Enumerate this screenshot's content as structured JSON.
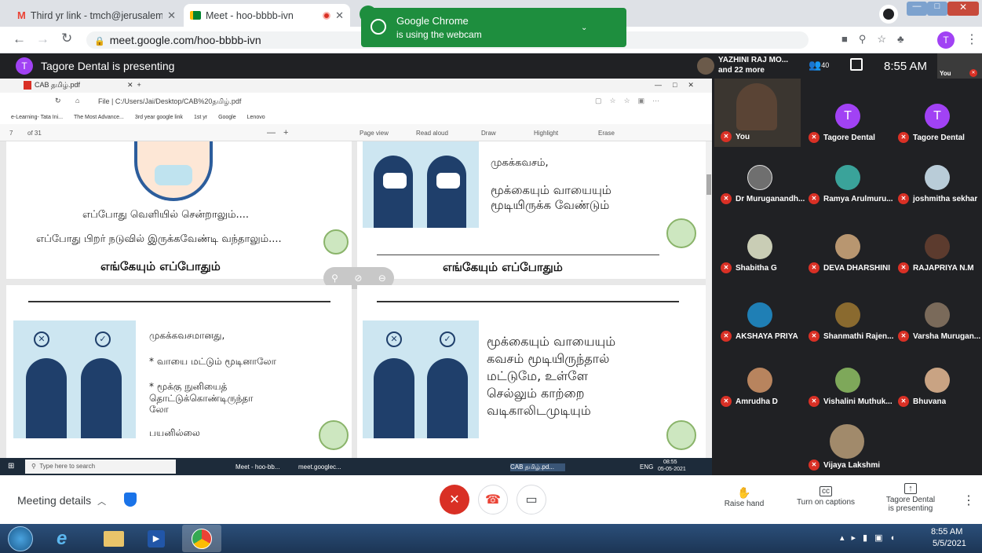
{
  "browser": {
    "tabs": [
      {
        "title": "Third yr link - tmch@jerusalemer",
        "icon": "gmail-icon"
      },
      {
        "title": "Meet - hoo-bbbb-ivn",
        "icon": "meet-icon"
      }
    ],
    "url": "meet.google.com/hoo-bbbb-ivn",
    "notification": {
      "line1": "Google Chrome",
      "line2": "is using the webcam"
    },
    "profile_initial": "T"
  },
  "meet_header": {
    "presenter_initial": "T",
    "presenting_text": "Tagore Dental is presenting",
    "speaker_name": "YAZHINI RAJ MO...",
    "speaker_more": "and 22 more",
    "people_count": "40",
    "time": "8:55 AM",
    "self_label": "You"
  },
  "shared_window": {
    "tab_title": "CAB தமிழ்.pdf",
    "address": "File  |  C:/Users/Jai/Desktop/CAB%20தமிழ்.pdf",
    "bookmarks": [
      "e-Learning- Tata Ini...",
      "The Most Advance...",
      "3rd year google link",
      "1st yr",
      "Google",
      "Lenovo"
    ],
    "page_num": "7",
    "page_total": "of 31",
    "toolbar": [
      "Page view",
      "Read aloud",
      "Draw",
      "Highlight",
      "Erase"
    ],
    "slide1_line1": "எப்போது வெளியில் சென்றாலும்....",
    "slide1_line2": "எப்போது பிறர் நடுவில் இருக்கவேண்டி வந்தாலும்....",
    "slide1_footer": "எங்கேயும் எப்போதும்",
    "slide2_line1": "முகக்கவசம்,",
    "slide2_line2": "மூக்கையும் வாயையும்",
    "slide2_line3": "மூடியிருக்க வேண்டும்",
    "slide2_footer": "எங்கேயும் எப்போதும்",
    "slide3_l1": "முகக்கவசமானது,",
    "slide3_l2": "* வாயை மட்டும் மூடினாலோ",
    "slide3_l3": "* மூக்கு நுனியைத்",
    "slide3_l4": "தொட்டுக்கொண்டிருந்தா",
    "slide3_l5": "லோ",
    "slide3_l6": "பயனில்லை",
    "slide4_l1": "மூக்கையும் வாயையும்",
    "slide4_l2": "கவசம் மூடியிருந்தால்",
    "slide4_l3": "மட்டுமே, உள்ளே",
    "slide4_l4": "செல்லும் காற்றை",
    "slide4_l5": "வடிகாலிடமுடியும்",
    "taskbar_search": "Type here to search",
    "taskbar_items": [
      "Meet - hoo-bb...",
      "meet.googlec...",
      "CAB தமிழ்.pd..."
    ],
    "taskbar_lang": "ENG",
    "taskbar_time": "08:55",
    "taskbar_date": "05-05-2021"
  },
  "participants": [
    {
      "name": "You",
      "type": "video"
    },
    {
      "name": "Tagore Dental",
      "type": "initial",
      "initial": "T"
    },
    {
      "name": "Tagore Dental",
      "type": "initial",
      "initial": "T"
    },
    {
      "name": "Dr Muruganandh...",
      "type": "photo"
    },
    {
      "name": "Ramya Arulmuru...",
      "type": "photo"
    },
    {
      "name": "joshmitha sekhar",
      "type": "photo"
    },
    {
      "name": "Shabitha G",
      "type": "photo"
    },
    {
      "name": "DEVA DHARSHINI",
      "type": "photo"
    },
    {
      "name": "RAJAPRIYA N.M",
      "type": "photo"
    },
    {
      "name": "AKSHAYA PRIYA",
      "type": "photo"
    },
    {
      "name": "Shanmathi Rajen...",
      "type": "photo"
    },
    {
      "name": "Varsha Murugan...",
      "type": "photo"
    },
    {
      "name": "Amrudha D",
      "type": "photo"
    },
    {
      "name": "Vishalini Muthuk...",
      "type": "photo"
    },
    {
      "name": "Bhuvana",
      "type": "photo"
    },
    {
      "name": "Vijaya Lakshmi",
      "type": "photo"
    }
  ],
  "bottom_bar": {
    "meeting_details": "Meeting details",
    "raise_hand": "Raise hand",
    "captions": "Turn on captions",
    "presenting_line1": "Tagore Dental",
    "presenting_line2": "is presenting"
  },
  "os_taskbar": {
    "time": "8:55 AM",
    "date": "5/5/2021"
  },
  "colors": {
    "meet_dark": "#202124",
    "end_call": "#ea4335",
    "mic_off": "#d93025",
    "initial_avatar": "#a142f4",
    "notification": "#1e8e3e"
  }
}
